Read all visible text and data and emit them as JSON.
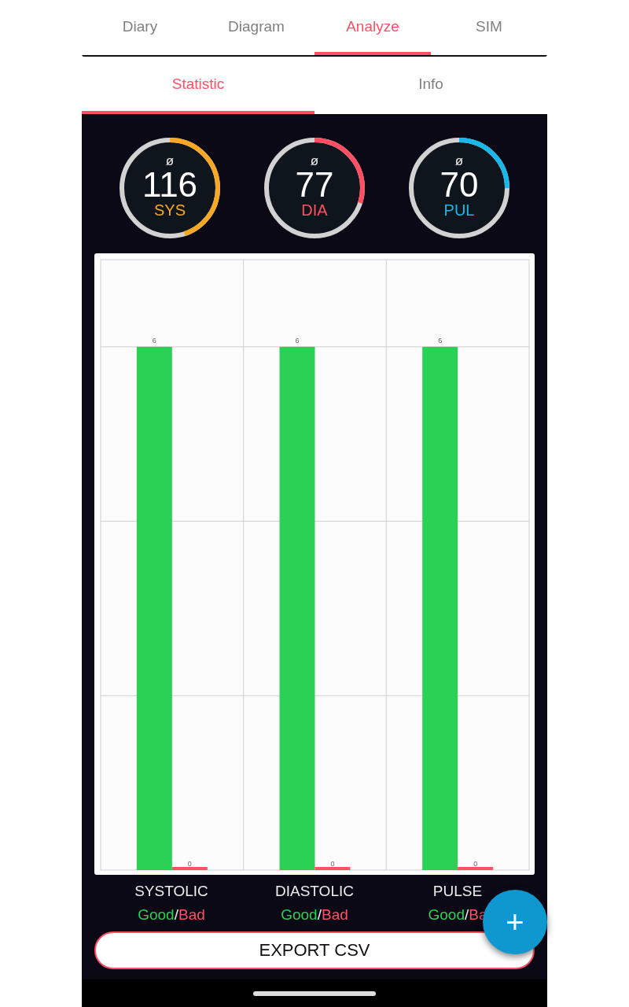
{
  "tabs": [
    {
      "label": "Diary",
      "selected": false
    },
    {
      "label": "Diagram",
      "selected": false
    },
    {
      "label": "Analyze",
      "selected": true
    },
    {
      "label": "SIM",
      "selected": false
    }
  ],
  "subtabs": [
    {
      "label": "Statistic",
      "selected": true
    },
    {
      "label": "Info",
      "selected": false
    }
  ],
  "gauges": [
    {
      "symbol": "ø",
      "value": "116",
      "label": "SYS",
      "color": "#f9a825",
      "level": 0.45
    },
    {
      "symbol": "ø",
      "value": "77",
      "label": "DIA",
      "color": "#ff4f64",
      "level": 0.3
    },
    {
      "symbol": "ø",
      "value": "70",
      "label": "PUL",
      "color": "#19b8ea",
      "level": 0.25
    }
  ],
  "chart": {
    "chart_data": {
      "type": "bar",
      "categories": [
        "SYSTOLIC",
        "DIASTOLIC",
        "PULSE"
      ],
      "series": [
        {
          "color": "#2ad155",
          "values": [
            6,
            6,
            6
          ]
        },
        {
          "color": "#ff5065",
          "values": [
            0,
            0,
            0
          ]
        }
      ],
      "ylim": [
        0,
        7
      ],
      "data_labels": true
    }
  },
  "legend": [
    {
      "good": "Good",
      "separator": "/",
      "bad": "Bad"
    },
    {
      "good": "Good",
      "separator": "/",
      "bad": "Bad"
    },
    {
      "good": "Good",
      "separator": "/",
      "bad": "Ba"
    }
  ],
  "export_button": "EXPORT CSV",
  "fab": "+"
}
